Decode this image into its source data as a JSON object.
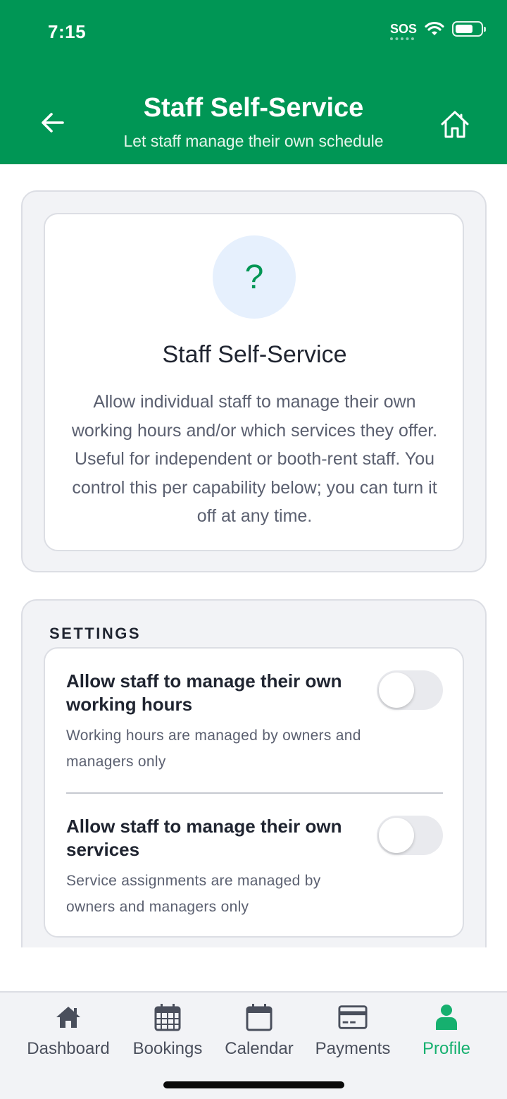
{
  "status_bar": {
    "time": "7:15",
    "carrier": "SOS"
  },
  "header": {
    "title": "Staff Self-Service",
    "subtitle": "Let staff manage their own schedule"
  },
  "intro": {
    "icon": "?",
    "title": "Staff Self-Service",
    "description": "Allow individual staff to manage their own working hours and/or which services they offer. Useful for independent or booth-rent staff. You control this per capability below; you can turn it off at any time."
  },
  "settings": {
    "section_label": "SETTINGS",
    "items": [
      {
        "title": "Allow staff to manage their own working hours",
        "description": "Working hours are managed by owners and managers only",
        "enabled": false
      },
      {
        "title": "Allow staff to manage their own services",
        "description": "Service assignments are managed by owners and managers only",
        "enabled": false
      }
    ]
  },
  "tabbar": {
    "items": [
      {
        "label": "Dashboard",
        "icon": "home-icon",
        "active": false
      },
      {
        "label": "Bookings",
        "icon": "calendar-grid-icon",
        "active": false
      },
      {
        "label": "Calendar",
        "icon": "calendar-icon",
        "active": false
      },
      {
        "label": "Payments",
        "icon": "credit-card-icon",
        "active": false
      },
      {
        "label": "Profile",
        "icon": "person-icon",
        "active": true
      }
    ]
  },
  "colors": {
    "brand_green": "#009655",
    "active_tab": "#16b06f",
    "help_circle_bg": "#e6f0fd"
  }
}
